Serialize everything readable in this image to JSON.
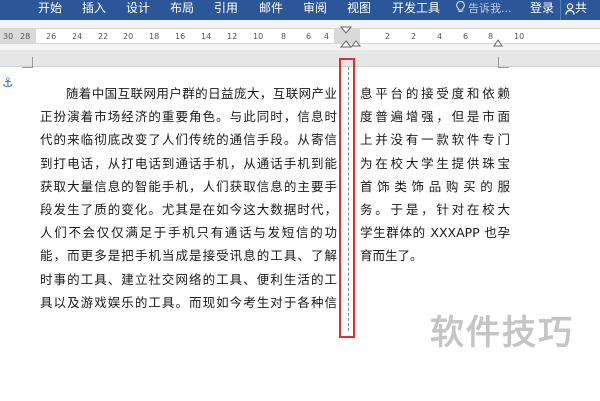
{
  "ribbon": {
    "tabs": [
      "开始",
      "插入",
      "设计",
      "布局",
      "引用",
      "邮件",
      "审阅",
      "视图",
      "开发工具"
    ],
    "tell_me": "告诉我...",
    "login": "登录",
    "share": "共"
  },
  "ruler": {
    "ticks": [
      "30",
      "28",
      "26",
      "24",
      "22",
      "20",
      "18",
      "16",
      "14",
      "12",
      "10",
      "8",
      "6",
      "4",
      "2",
      "2",
      "4",
      "6",
      "8",
      "10"
    ]
  },
  "document": {
    "left_column": [
      "　　随着中国互联网用户群的日益庞大，互联网产业",
      "正扮演着市场经济的重要角色。与此同时，信息时",
      "代的来临彻底改变了人们传统的通信手段。从寄信",
      "到打电话，从打电话到通话手机，从通话手机到能",
      "获取大量信息的智能手机，人们获取信息的主要手",
      "段发生了质的变化。尤其是在如今这大数据时代，",
      "人们不会仅仅满足于手机只有通话与发短信的功",
      "能，而更多是把手机当成是接受讯息的工具、了解",
      "时事的工具、建立社交网络的工具、便利生活的工",
      "具以及游戏娱乐的工具。而现如今考生对于各种信"
    ],
    "right_column": [
      "息平台的接受度和依赖",
      "度普遍增强，但是市面",
      "上并没有一款软件专门",
      "为在校大学生提供珠宝",
      "首饰类饰品购买的服",
      "务。于是，针对在校大",
      "学生群体的 XXXAPP 也孕",
      "育而生了。"
    ],
    "anchor_icon": "anchor-icon"
  },
  "watermark": "软件技巧",
  "colors": {
    "ribbon": "#2b579a",
    "highlight": "#e0302b",
    "anchor": "#2b6fd1"
  }
}
